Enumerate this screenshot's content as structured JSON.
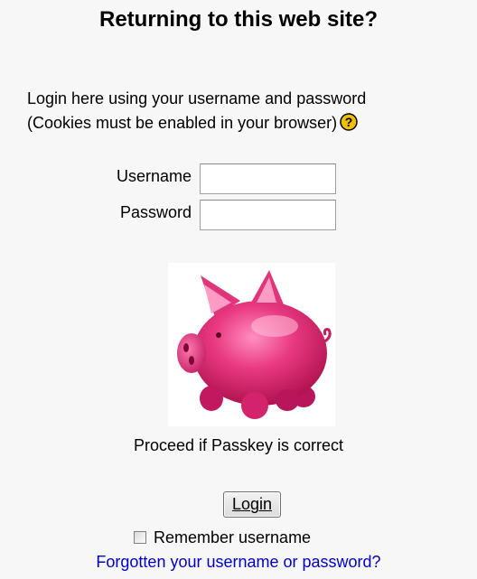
{
  "heading": "Returning to this web site?",
  "intro": {
    "line1": "Login here using your username and password",
    "line2": "(Cookies must be enabled in your browser)",
    "help_icon": "question-mark-icon",
    "help_icon_color": "#f0c000"
  },
  "form": {
    "username_label": "Username",
    "username_value": "",
    "password_label": "Password",
    "password_value": ""
  },
  "passkey_image": "pink-piggy-bank",
  "passkey_text": "Proceed if Passkey is correct",
  "login_button": "Login",
  "remember_label": "Remember username",
  "remember_checked": false,
  "forgot_link": "Forgotten your username or password?",
  "colors": {
    "background": "#f7f7f7",
    "link": "#0000cc",
    "pig": "#e8337a"
  }
}
